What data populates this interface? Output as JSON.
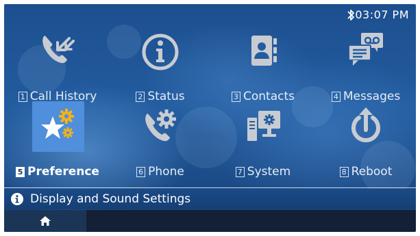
{
  "status_bar": {
    "time": "03:07 PM",
    "bluetooth_icon": "bluetooth-icon"
  },
  "menu": {
    "items": [
      {
        "number": "1",
        "label": "Call History",
        "icon": "call-history-icon",
        "selected": false
      },
      {
        "number": "2",
        "label": "Status",
        "icon": "info-circle-icon",
        "selected": false
      },
      {
        "number": "3",
        "label": "Contacts",
        "icon": "contacts-book-icon",
        "selected": false
      },
      {
        "number": "4",
        "label": "Messages",
        "icon": "messages-icon",
        "selected": false
      },
      {
        "number": "5",
        "label": "Preference",
        "icon": "preference-star-gear-icon",
        "selected": true
      },
      {
        "number": "6",
        "label": "Phone",
        "icon": "phone-gear-icon",
        "selected": false
      },
      {
        "number": "7",
        "label": "System",
        "icon": "system-computer-icon",
        "selected": false
      },
      {
        "number": "8",
        "label": "Reboot",
        "icon": "reboot-power-icon",
        "selected": false
      }
    ]
  },
  "info_bar": {
    "icon": "info-icon",
    "text": "Display and Sound Settings"
  },
  "bottom_bar": {
    "home_icon": "home-icon"
  },
  "colors": {
    "background": "#225c9f",
    "selected_highlight": "#4f8fdb",
    "icon_gray": "#c8ccd2",
    "gear_orange": "#f2b21b"
  }
}
